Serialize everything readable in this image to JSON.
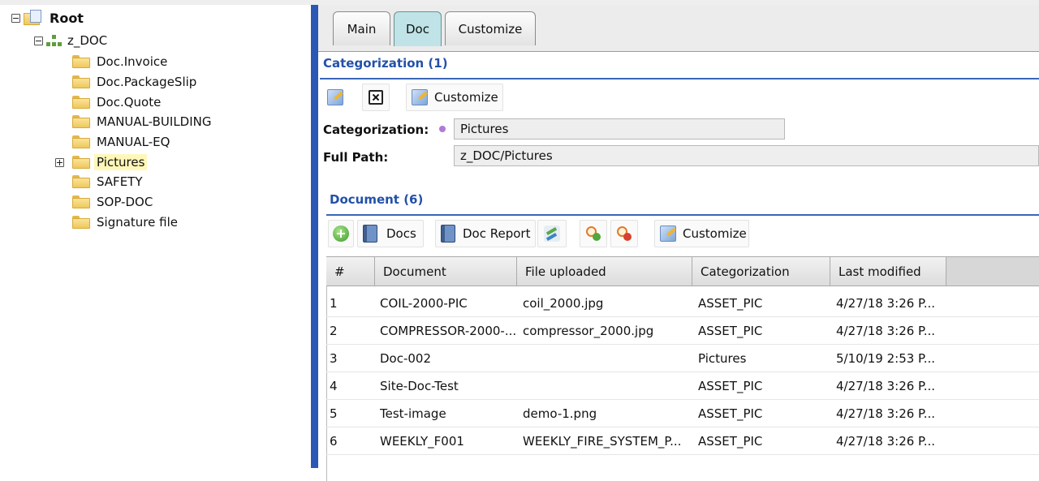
{
  "tree": {
    "root": "Root",
    "child": "z_DOC",
    "folders": [
      "Doc.Invoice",
      "Doc.PackageSlip",
      "Doc.Quote",
      "MANUAL-BUILDING",
      "MANUAL-EQ",
      "Pictures",
      "SAFETY",
      "SOP-DOC",
      "Signature file"
    ],
    "selected": "Pictures"
  },
  "tabs": [
    "Main",
    "Doc",
    "Customize"
  ],
  "active_tab": "Doc",
  "categorization": {
    "title": "Categorization (1)",
    "customize_label": "Customize",
    "label": "Categorization:",
    "value": "Pictures",
    "path_label": "Full Path:",
    "path_value": "z_DOC/Pictures"
  },
  "document": {
    "title": "Document (6)",
    "toolbar": {
      "docs": "Docs",
      "doc_report": "Doc Report",
      "customize": "Customize"
    },
    "columns": [
      "#",
      "Document",
      "File uploaded",
      "Categorization",
      "Last modified"
    ],
    "rows": [
      [
        "1",
        "COIL-2000-PIC",
        "coil_2000.jpg",
        "ASSET_PIC",
        "4/27/18 3:26 P..."
      ],
      [
        "2",
        "COMPRESSOR-2000-...",
        "compressor_2000.jpg",
        "ASSET_PIC",
        "4/27/18 3:26 P..."
      ],
      [
        "3",
        "Doc-002",
        "",
        "Pictures",
        "5/10/19 2:53 P..."
      ],
      [
        "4",
        "Site-Doc-Test",
        "",
        "ASSET_PIC",
        "4/27/18 3:26 P..."
      ],
      [
        "5",
        "Test-image",
        "demo-1.png",
        "ASSET_PIC",
        "4/27/18 3:26 P..."
      ],
      [
        "6",
        "WEEKLY_F001",
        "WEEKLY_FIRE_SYSTEM_P...",
        "ASSET_PIC",
        "4/27/18 3:26 P..."
      ]
    ]
  },
  "icons": [
    "expand-collapse-icon",
    "folder-icon",
    "org-structure-icon",
    "edit-icon",
    "delete-icon",
    "add-icon",
    "book-icon",
    "refresh-icon",
    "zoom-in-icon",
    "zoom-out-icon"
  ],
  "colors": {
    "accent": "#2351a8",
    "divider": "#2a58b4",
    "active_tab": "#bfe3e6",
    "selected": "#fff7b8"
  }
}
